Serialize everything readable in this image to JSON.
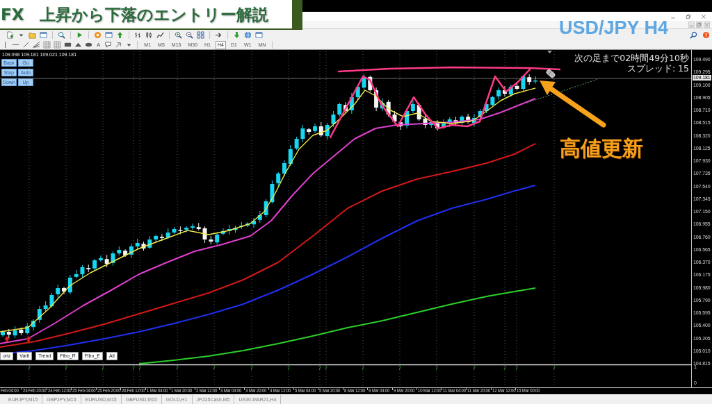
{
  "banner": {
    "title": "FX　上昇から下落のエントリー解説"
  },
  "overlay_label": "USD/JPY H4",
  "toolbar": {
    "text_tool": "A",
    "timeframes": [
      {
        "label": "M1",
        "selected": false
      },
      {
        "label": "M5",
        "selected": false
      },
      {
        "label": "M15",
        "selected": false
      },
      {
        "label": "M30",
        "selected": false
      },
      {
        "label": "H1",
        "selected": false
      },
      {
        "label": "H4",
        "selected": true
      },
      {
        "label": "D1",
        "selected": false
      },
      {
        "label": "W1",
        "selected": false
      },
      {
        "label": "MN",
        "selected": false
      }
    ]
  },
  "chart": {
    "ohlc_readout": "109.098 109.181 109.021 109.181",
    "nav_buttons": [
      "Back",
      "Go",
      "Stop",
      "Auto",
      "Down",
      "Up"
    ],
    "info_lines": [
      "次の足まで02時間49分10秒",
      "スプレッド: 15"
    ],
    "annotation": "高値更新",
    "draw_buttons": [
      "oriz",
      "Varti",
      "Trend",
      "Fibo_R",
      "Fibo_E",
      "All"
    ],
    "signal_marks": [
      "7",
      "7",
      "7",
      "7",
      "7",
      "7",
      "7",
      "7",
      "7",
      "7",
      "7",
      "7",
      "7",
      "7",
      "7",
      "7",
      "7",
      "7"
    ],
    "price_axis": {
      "labels": [
        "109.490",
        "109.295",
        "109.100",
        "108.905",
        "108.710",
        "108.515",
        "108.320",
        "108.125",
        "107.930",
        "107.735",
        "107.540",
        "107.345",
        "107.150",
        "106.955",
        "106.760",
        "106.565",
        "106.370",
        "106.175",
        "105.980",
        "105.790",
        "105.595",
        "105.400",
        "105.205",
        "105.010",
        "104.815"
      ],
      "current": "109.181"
    },
    "indicator_axis": [
      "1",
      "0"
    ],
    "time_axis": [
      "Feb 04:00",
      "23 Feb 20:00",
      "24 Feb 12:00",
      "25 Feb 04:00",
      "25 Feb 20:00",
      "26 Feb 12:00",
      "1 Mar 04:00",
      "1 Mar 20:00",
      "2 Mar 12:00",
      "3 Mar 04:00",
      "3 Mar 20:00",
      "4 Mar 12:00",
      "5 Mar 04:00",
      "5 Mar 20:00",
      "8 Mar 12:00",
      "9 Mar 04:00",
      "9 Mar 20:00",
      "10 Mar 12:00",
      "11 Mar 04:00",
      "11 Mar 20:00",
      "12 Mar 12:00",
      "15 Mar 00:00"
    ]
  },
  "tabs": [
    {
      "label": "EURJPY,M15",
      "selected": false
    },
    {
      "label": "GBPJPY,M15",
      "selected": false
    },
    {
      "label": "EURUSD,M15",
      "selected": false
    },
    {
      "label": "GBPUSD,M15",
      "selected": false
    },
    {
      "label": "GOLD,H1",
      "selected": false
    },
    {
      "label": "JP225Cash,M5",
      "selected": false
    },
    {
      "label": "US30-MAR21,H4",
      "selected": false
    }
  ]
}
